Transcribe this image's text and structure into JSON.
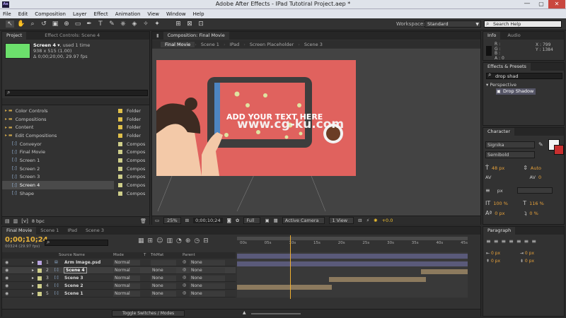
{
  "window": {
    "title": "Adobe After Effects - IPad Tutotiral Project.aep *",
    "app_icon": "Ae"
  },
  "menu": [
    "File",
    "Edit",
    "Composition",
    "Layer",
    "Effect",
    "Animation",
    "View",
    "Window",
    "Help"
  ],
  "toolbar": {
    "workspace_label": "Workspace:",
    "workspace_value": "Standard",
    "search_placeholder": "Search Help"
  },
  "project": {
    "tab": "Project",
    "effect_tab": "Effect Controls: Scene 4",
    "item_name": "Screen 4 ▾",
    "used": ", used 1 time",
    "dims": "938 x 515 (1.00)",
    "duration": "Δ 0;00;20;00, 29.97 fps",
    "bpc": "8 bpc",
    "items": [
      {
        "name": "Color Controls",
        "type": "Folder",
        "kind": "folder",
        "indent": 0
      },
      {
        "name": "Compositions",
        "type": "Folder",
        "kind": "folder",
        "indent": 0
      },
      {
        "name": "Content",
        "type": "Folder",
        "kind": "folder",
        "indent": 0
      },
      {
        "name": "Edit Compositions",
        "type": "Folder",
        "kind": "folder",
        "indent": 0
      },
      {
        "name": "Conveyor",
        "type": "Compos",
        "kind": "comp",
        "indent": 1
      },
      {
        "name": "Final Movie",
        "type": "Compos",
        "kind": "comp",
        "indent": 1
      },
      {
        "name": "Screen 1",
        "type": "Compos",
        "kind": "comp",
        "indent": 1
      },
      {
        "name": "Screen 2",
        "type": "Compos",
        "kind": "comp",
        "indent": 1
      },
      {
        "name": "Screen 3",
        "type": "Compos",
        "kind": "comp",
        "indent": 1
      },
      {
        "name": "Screen 4",
        "type": "Compos",
        "kind": "comp",
        "indent": 1,
        "selected": true
      },
      {
        "name": "Shape",
        "type": "Compos",
        "kind": "comp",
        "indent": 1
      }
    ]
  },
  "composition": {
    "panel_tab": "Composition: Final Movie",
    "tabs": [
      "Final Movie",
      "Scene 1",
      "IPad",
      "Screen Placeholder",
      "Scene 3"
    ],
    "canvas_text": "ADD YOUR TEXT HERE",
    "watermark": "www.cg-ku.com",
    "zoom": "25%",
    "timecode": "0;00;10;24",
    "resolution": "Full",
    "camera": "Active Camera",
    "view": "1 View",
    "exposure": "+0.0",
    "colors": {
      "bg": "#e0625e",
      "screen": "#e0625e",
      "frame": "#3d3d3d",
      "skin": "#f3c9a8",
      "hair": "#3d2b22",
      "dots": "#dfe3a0",
      "cup": "#6b3d25"
    }
  },
  "info": {
    "tab": "Info",
    "audio_tab": "Audio",
    "r": "R :",
    "g": "G :",
    "b": "B :",
    "a": "A : 0",
    "x": "X : 799",
    "y": "Y : 1384"
  },
  "effects": {
    "tab": "Effects & Presets",
    "search_value": "drop shad",
    "category": "Perspective",
    "item": "Drop Shadow"
  },
  "character": {
    "tab": "Character",
    "font": "Signika",
    "style": "Semibold",
    "size": "48 px",
    "leading": "Auto",
    "tracking": "0",
    "unit": "px",
    "vscale": "100 %",
    "hscale": "116 %",
    "baseline": "0 px",
    "tsume": "0 %"
  },
  "timeline": {
    "tabs": [
      "Final Movie",
      "Scene 1",
      "IPad",
      "Scene 3"
    ],
    "timecode": "0;00;10;24",
    "fps_info": "00324 (29.97 fps)",
    "col_name": "Source Name",
    "col_mode": "Mode",
    "col_t": "T",
    "col_trkmat": "TrkMat",
    "col_parent": "Parent",
    "footer": "Toggle Switches / Modes",
    "ruler": [
      "00s",
      "05s",
      "10s",
      "15s",
      "20s",
      "25s",
      "30s",
      "35s",
      "40s",
      "45s"
    ],
    "playhead_time_s": 10.8,
    "layers": [
      {
        "num": "1",
        "name": "Arm Image.psd",
        "mode": "Normal",
        "trkmat": "",
        "parent": "None",
        "in": 0,
        "out": 47,
        "kind": "footage"
      },
      {
        "num": "2",
        "name": "Scene 4",
        "mode": "Normal",
        "trkmat": "None",
        "parent": "None",
        "in": 0,
        "out": 47,
        "kind": "comp",
        "selected": true
      },
      {
        "num": "3",
        "name": "Scene 3",
        "mode": "Normal",
        "trkmat": "None",
        "parent": "None",
        "in": 37.5,
        "out": 47,
        "kind": "comp"
      },
      {
        "num": "4",
        "name": "Scene 2",
        "mode": "Normal",
        "trkmat": "None",
        "parent": "None",
        "in": 18.7,
        "out": 38.5,
        "kind": "comp"
      },
      {
        "num": "5",
        "name": "Scene 1",
        "mode": "Normal",
        "trkmat": "None",
        "parent": "None",
        "in": 0,
        "out": 19.3,
        "kind": "comp"
      }
    ]
  },
  "paragraph": {
    "tab": "Paragraph",
    "v1": "0 px",
    "v2": "0 px",
    "v3": "0 px",
    "v4": "0 px"
  }
}
